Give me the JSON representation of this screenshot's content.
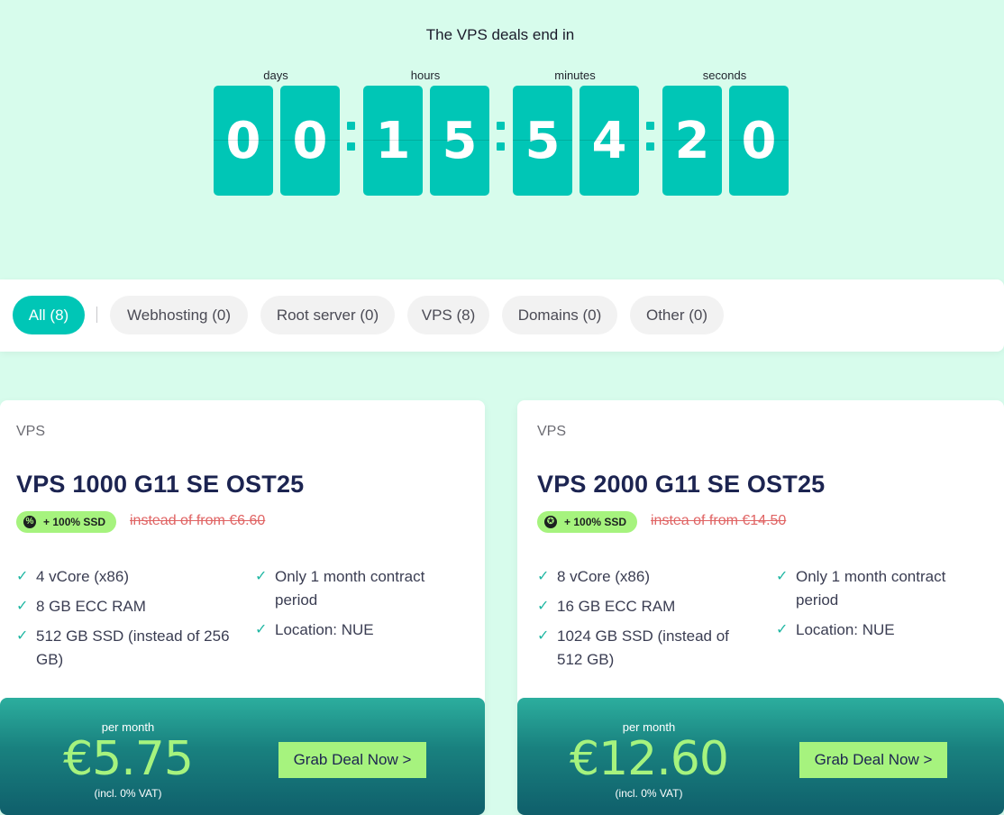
{
  "countdown": {
    "title": "The VPS deals end in",
    "labels": {
      "days": "days",
      "hours": "hours",
      "minutes": "minutes",
      "seconds": "seconds"
    },
    "digits": [
      "0",
      "0",
      "1",
      "5",
      "5",
      "4",
      "2",
      "0"
    ]
  },
  "filters": [
    {
      "label": "All (8)",
      "active": true
    },
    {
      "label": "Webhosting (0)",
      "active": false
    },
    {
      "label": "Root server (0)",
      "active": false
    },
    {
      "label": "VPS (8)",
      "active": false
    },
    {
      "label": "Domains (0)",
      "active": false
    },
    {
      "label": "Other (0)",
      "active": false
    }
  ],
  "cards": [
    {
      "category": "VPS",
      "title": "VPS 1000 G11 SE OST25",
      "badge_icon": "%",
      "badge": "+ 100% SSD",
      "strike_price": "instead of from €6.60",
      "features_left": [
        "4 vCore (x86)",
        "8 GB ECC RAM",
        "512 GB SSD (instead of 256 GB)"
      ],
      "features_right": [
        "Only 1 month contract period",
        "Location: NUE"
      ],
      "per_month": "per month",
      "price": "€5.75",
      "vat": "(incl. 0% VAT)",
      "cta": "Grab Deal Now >"
    },
    {
      "category": "VPS",
      "title": "VPS 2000 G11 SE OST25",
      "badge_icon": "✪",
      "badge": "+ 100% SSD",
      "strike_price": "instea of from €14.50",
      "features_left": [
        "8 vCore (x86)",
        "16 GB ECC RAM",
        "1024 GB SSD (instead of 512 GB)"
      ],
      "features_right": [
        "Only 1 month contract period",
        "Location: NUE"
      ],
      "per_month": "per month",
      "price": "€12.60",
      "vat": "(incl. 0% VAT)",
      "cta": "Grab Deal Now >"
    }
  ],
  "colors": {
    "background": "#d7fcec",
    "accent": "#00c6b6",
    "lime": "#a6f37e",
    "navy": "#1c2451",
    "strike": "#e06464"
  }
}
